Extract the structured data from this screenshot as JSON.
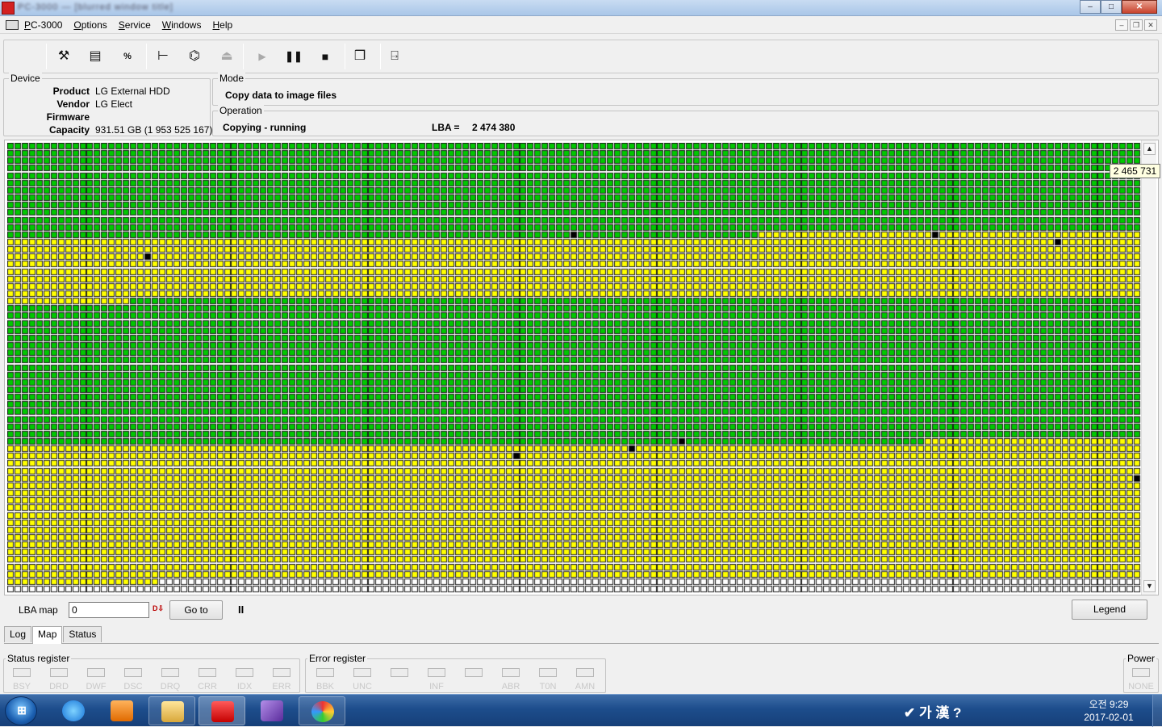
{
  "window": {
    "title": "PC-3000 — [blurred window title]",
    "controls": [
      "–",
      "□",
      "✕"
    ]
  },
  "menu": {
    "items": [
      "PC-3000",
      "Options",
      "Service",
      "Windows",
      "Help"
    ]
  },
  "toolbar": {
    "buttons": [
      "tools-icon",
      "chip-icon",
      "percent-icon",
      "tree-icon",
      "binoculars-icon",
      "eject-icon",
      "play-icon",
      "pause-icon",
      "stop-icon",
      "windows-icon",
      "exit-icon"
    ]
  },
  "device": {
    "title": "Device",
    "rows": [
      {
        "label": "Product",
        "value": "LG External HDD"
      },
      {
        "label": "Vendor",
        "value": "LG Elect"
      },
      {
        "label": "Firmware",
        "value": ""
      },
      {
        "label": "Capacity",
        "value": "931.51 GB (1 953 525 167)"
      }
    ]
  },
  "mode": {
    "title": "Mode",
    "value": "Copy data to image files"
  },
  "operation": {
    "title": "Operation",
    "status": "Copying - running",
    "lba_label": "LBA =",
    "lba_value": "2 474 380"
  },
  "map": {
    "tooltip": "2 465 731",
    "colors": {
      "green": "#00c800",
      "yellow": "#ffff00",
      "empty": "#ffffff",
      "bad": "#000000",
      "border": "#1e1e1e"
    },
    "rows": 61,
    "cols": 157,
    "runs": [
      {
        "from": 0,
        "to": 1987,
        "state": "green"
      },
      {
        "from": 1988,
        "to": 3313,
        "state": "yellow"
      },
      {
        "from": 3314,
        "to": 6406,
        "state": "green"
      },
      {
        "from": 6407,
        "to": 9283,
        "state": "yellow"
      },
      {
        "from": 9284,
        "to": 9576,
        "state": "empty"
      }
    ],
    "bad_cells": [
      1962,
      2012,
      2186,
      2374,
      6373,
      6523,
      6664,
      7221
    ]
  },
  "lba_bar": {
    "label": "LBA map",
    "input_value": "0",
    "goto": "Go to",
    "pause": "II",
    "legend": "Legend"
  },
  "tabs": [
    "Log",
    "Map",
    "Status"
  ],
  "status_register": {
    "title": "Status register",
    "bits": [
      "BSY",
      "DRD",
      "DWF",
      "DSC",
      "DRQ",
      "CRR",
      "IDX",
      "ERR"
    ]
  },
  "error_register": {
    "title": "Error register",
    "bits": [
      "BBK",
      "UNC",
      "",
      "INF",
      "",
      "ABR",
      "T0N",
      "AMN"
    ]
  },
  "power": {
    "title": "Power",
    "bit": "NONE"
  },
  "taskbar": {
    "start": "⊞",
    "apps": [
      "ie-icon",
      "media-player-icon",
      "explorer-icon",
      "pc3000-icon",
      "visual-studio-icon",
      "paint-icon"
    ],
    "ime": "✔ 가 漢  ?",
    "time": "오전 9:29",
    "date": "2017-02-01"
  }
}
